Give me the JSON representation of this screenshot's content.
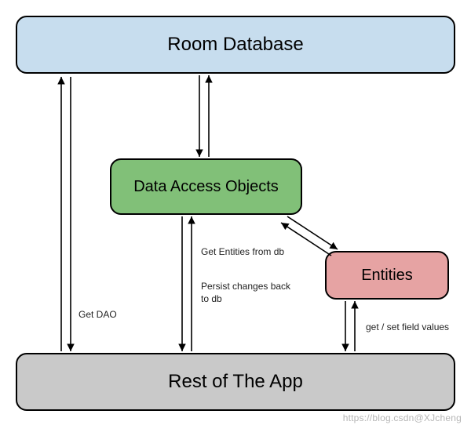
{
  "boxes": {
    "room": {
      "label": "Room Database"
    },
    "dao": {
      "label": "Data Access Objects"
    },
    "ent": {
      "label": "Entities"
    },
    "rest": {
      "label": "Rest of The App"
    }
  },
  "notes": {
    "get_dao": "Get DAO",
    "get_entities": "Get Entities from db",
    "persist": "Persist changes back to db",
    "getset": "get / set field values"
  },
  "watermark": "https://blog.csdn@XJcheng",
  "colors": {
    "room": "#c7ddee",
    "dao": "#81c078",
    "ent": "#e6a3a3",
    "rest": "#c9c9c9",
    "border": "#000000"
  },
  "chart_data": {
    "type": "diagram",
    "title": "Room persistence library architecture",
    "nodes": [
      {
        "id": "room",
        "label": "Room Database"
      },
      {
        "id": "dao",
        "label": "Data Access Objects"
      },
      {
        "id": "ent",
        "label": "Entities"
      },
      {
        "id": "rest",
        "label": "Rest of The App"
      }
    ],
    "edges": [
      {
        "from": "rest",
        "to": "room",
        "label": "Get DAO",
        "bidirectional": true
      },
      {
        "from": "rest",
        "to": "dao",
        "label": "Get Entities from db / Persist changes back to db",
        "bidirectional": true
      },
      {
        "from": "rest",
        "to": "ent",
        "label": "get / set field values",
        "bidirectional": true
      },
      {
        "from": "room",
        "to": "dao",
        "label": "",
        "bidirectional": true
      },
      {
        "from": "dao",
        "to": "ent",
        "label": "",
        "bidirectional": true
      }
    ]
  }
}
